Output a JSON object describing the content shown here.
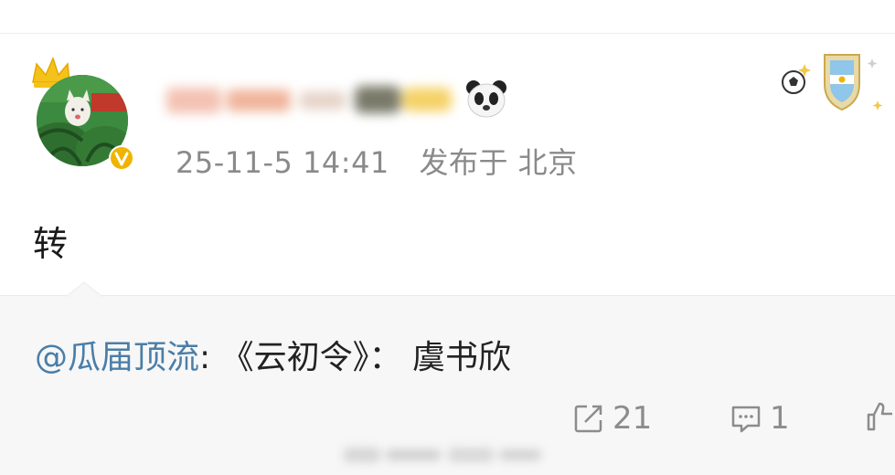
{
  "post": {
    "timestamp": "25-11-5 14:41",
    "location": "发布于 北京",
    "content": "转"
  },
  "repost": {
    "mention": "@瓜届顶流",
    "separator": ":",
    "text": "《云初令》： 虞书欣"
  },
  "actions": {
    "share_count": "21",
    "comment_count": "1"
  },
  "icons": {
    "crown": "crown-icon",
    "verified": "verified-v-icon",
    "panda": "panda-icon",
    "soccer": "soccer-ball-icon",
    "fan_badge": "shield-badge-icon",
    "share": "share-icon",
    "comment": "comment-icon",
    "like": "thumbs-up-icon"
  },
  "colors": {
    "mention": "#4a7ea8",
    "meta": "#8a8a8a",
    "repost_bg": "#f7f7f7",
    "badge_gold": "#f0b400"
  }
}
